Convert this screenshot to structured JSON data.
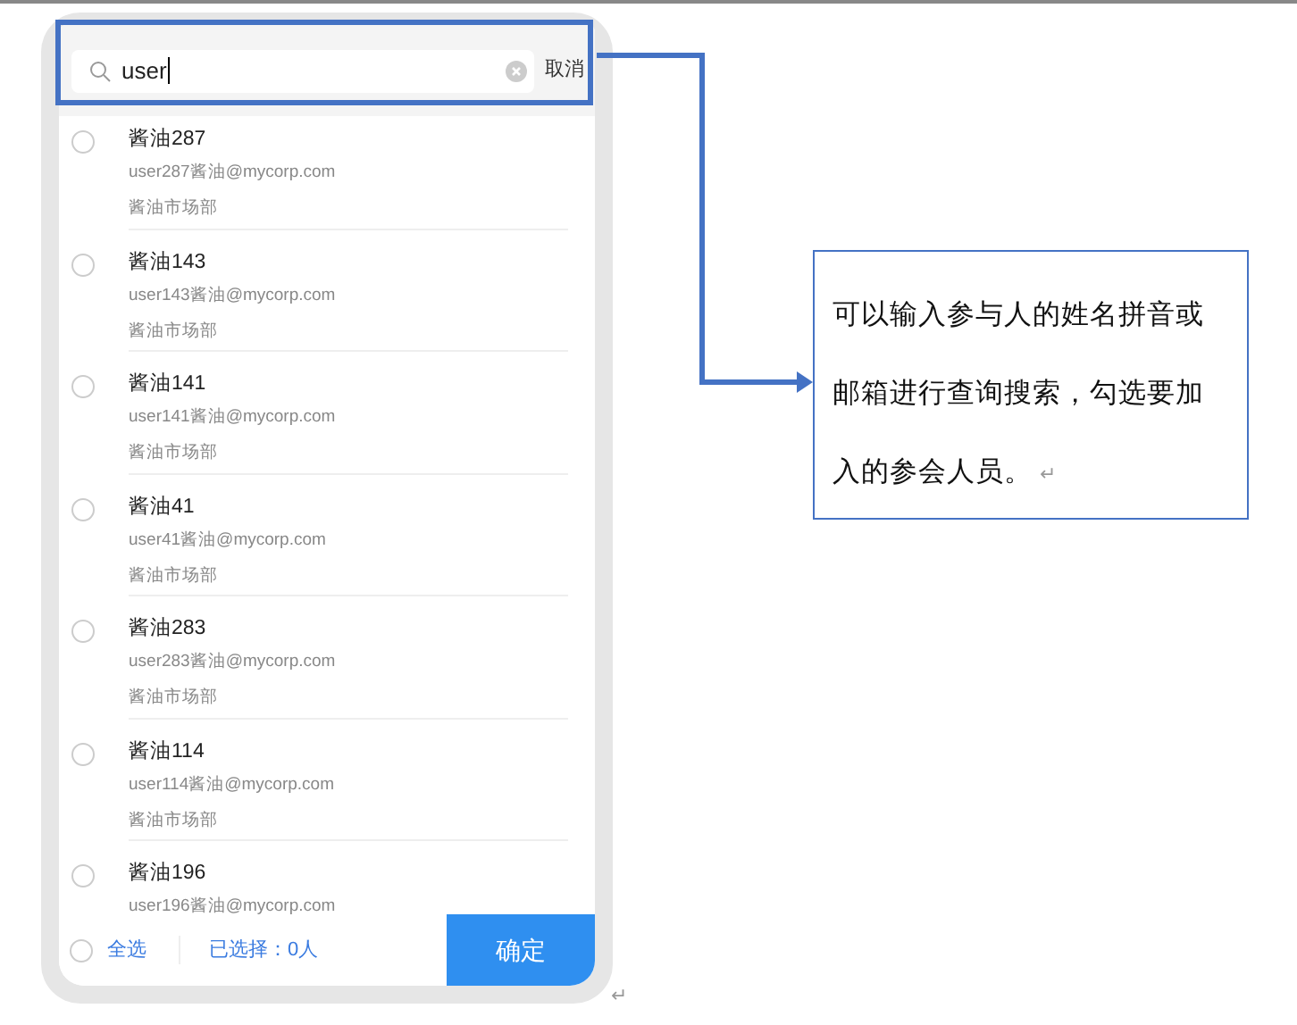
{
  "search": {
    "value": "user",
    "cancel": "取消"
  },
  "contacts": [
    {
      "name": "酱油287",
      "email": "user287酱油@mycorp.com",
      "department": "酱油市场部",
      "selected": false
    },
    {
      "name": "酱油143",
      "email": "user143酱油@mycorp.com",
      "department": "酱油市场部",
      "selected": false
    },
    {
      "name": "酱油141",
      "email": "user141酱油@mycorp.com",
      "department": "酱油市场部",
      "selected": false
    },
    {
      "name": "酱油41",
      "email": "user41酱油@mycorp.com",
      "department": "酱油市场部",
      "selected": false
    },
    {
      "name": "酱油283",
      "email": "user283酱油@mycorp.com",
      "department": "酱油市场部",
      "selected": false
    },
    {
      "name": "酱油114",
      "email": "user114酱油@mycorp.com",
      "department": "酱油市场部",
      "selected": false
    },
    {
      "name": "酱油196",
      "email": "user196酱油@mycorp.com",
      "selected": false
    }
  ],
  "footer": {
    "select_all": "全选",
    "all_selected": false,
    "selected_count": "已选择：0人",
    "confirm": "确定"
  },
  "callout": {
    "text": "可以输入参与人的姓名拼音或邮箱进行查询搜索，勾选要加入的参会人员。",
    "mark": "↵"
  },
  "page_mark": "↵"
}
